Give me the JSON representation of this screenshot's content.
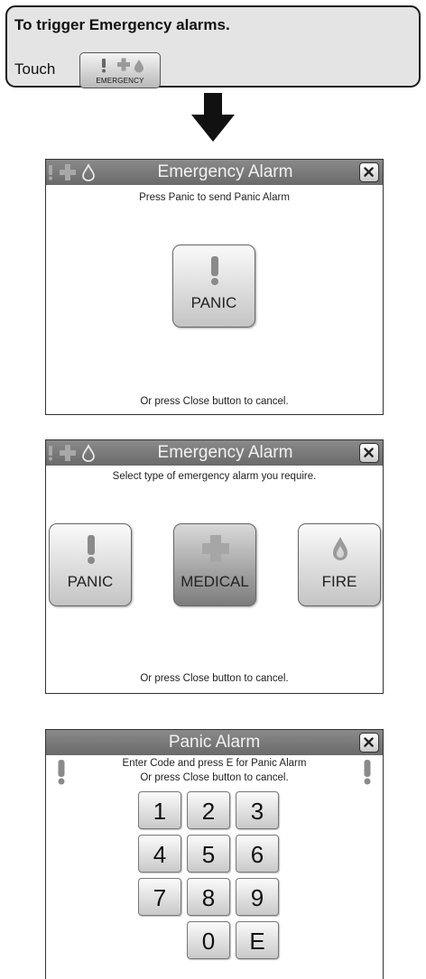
{
  "instruction": {
    "title": "To trigger Emergency alarms.",
    "touch_label": "Touch",
    "emergency_button_label": "EMERGENCY"
  },
  "screens": [
    {
      "title": "Emergency Alarm",
      "subtitle": "Press Panic to send Panic Alarm",
      "buttons": [
        "PANIC"
      ],
      "footer": "Or press Close button to cancel."
    },
    {
      "title": "Emergency Alarm",
      "subtitle": "Select type of emergency alarm you require.",
      "buttons": [
        "PANIC",
        "MEDICAL",
        "FIRE"
      ],
      "footer": "Or press Close button to cancel."
    },
    {
      "title": "Panic Alarm",
      "subtitle_line1": "Enter Code and press E for Panic Alarm",
      "subtitle_line2": "Or press Close button to cancel.",
      "keys": [
        "1",
        "2",
        "3",
        "4",
        "5",
        "6",
        "7",
        "8",
        "9",
        "0",
        "E"
      ]
    }
  ],
  "icons": [
    "exclamation-icon",
    "medical-cross-icon",
    "fire-drop-icon",
    "close-icon",
    "down-arrow-icon"
  ],
  "colors": {
    "titlebar": "#777777",
    "button_gray": "#c4c4c4",
    "medical_selected": "#7c7c7c",
    "callout_bg": "#e4e4e4"
  }
}
